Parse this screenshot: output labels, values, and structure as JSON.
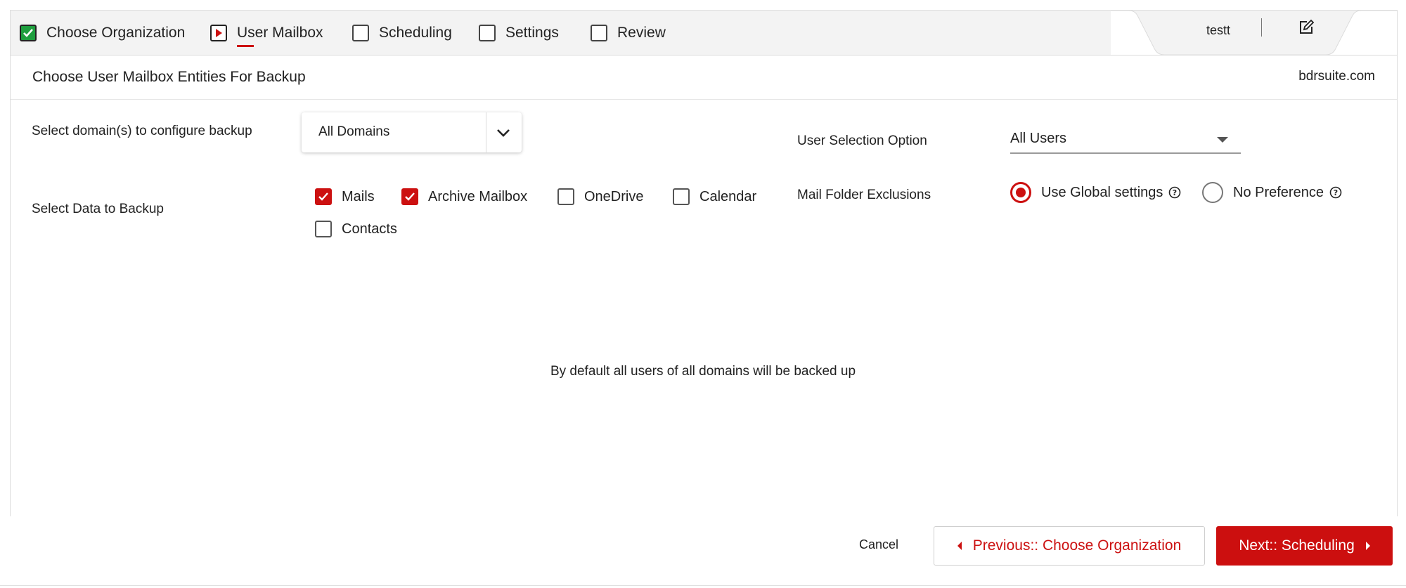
{
  "wizard": {
    "steps": [
      {
        "label": "Choose Organization",
        "state": "done"
      },
      {
        "label": "User Mailbox",
        "state": "active"
      },
      {
        "label": "Scheduling",
        "state": "pending"
      },
      {
        "label": "Settings",
        "state": "pending"
      },
      {
        "label": "Review",
        "state": "pending"
      }
    ],
    "job_name": "testt",
    "edit_icon": "edit-icon"
  },
  "header": {
    "title": "Choose User Mailbox Entities For Backup",
    "site": "bdrsuite.com"
  },
  "form": {
    "domain_label": "Select domain(s) to configure backup",
    "domain_value": "All Domains",
    "data_label": "Select Data to Backup",
    "data_options": [
      {
        "label": "Mails",
        "checked": true
      },
      {
        "label": "Archive Mailbox",
        "checked": true
      },
      {
        "label": "OneDrive",
        "checked": false
      },
      {
        "label": "Calendar",
        "checked": false
      },
      {
        "label": "Contacts",
        "checked": false
      }
    ],
    "user_selection_label": "User Selection Option",
    "user_selection_value": "All Users",
    "exclusions_label": "Mail Folder Exclusions",
    "exclusion_options": [
      {
        "label": "Use Global settings",
        "selected": true
      },
      {
        "label": "No Preference",
        "selected": false
      }
    ]
  },
  "info_text": "By default all users of all domains will be backed up",
  "footer": {
    "cancel_label": "Cancel",
    "prev_label": "Previous:: Choose Organization",
    "next_label": "Next:: Scheduling"
  },
  "colors": {
    "accent": "#cc1111",
    "done": "#1e9e3e"
  }
}
